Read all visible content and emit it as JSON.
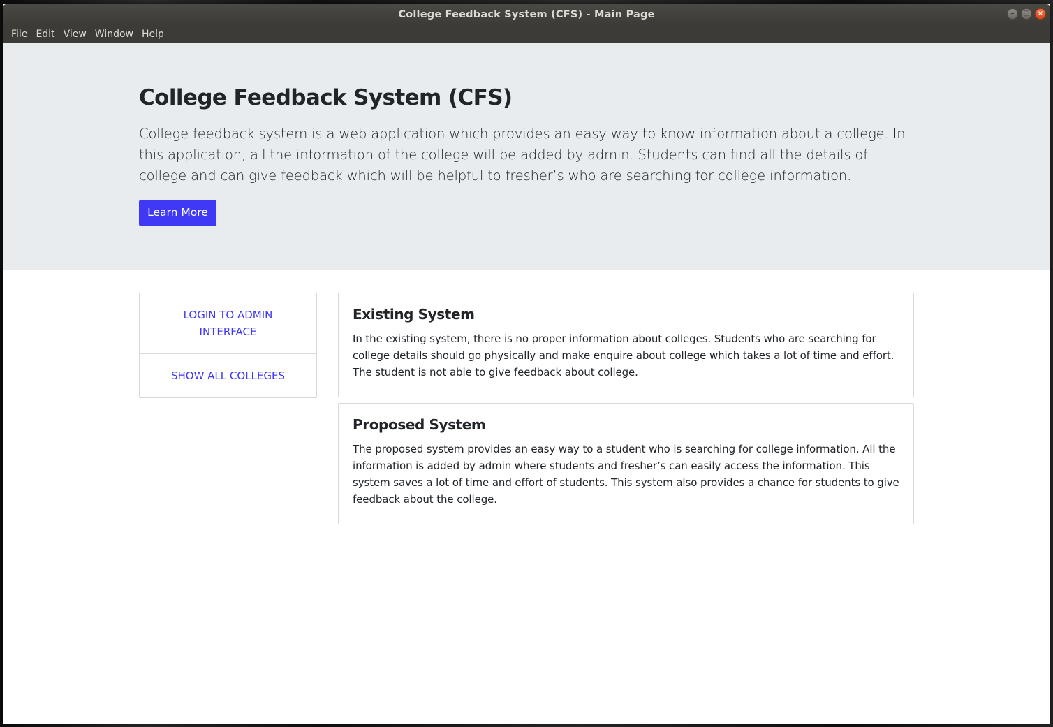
{
  "window": {
    "title": "College Feedback System (CFS) - Main Page",
    "controls": {
      "minimize": "–",
      "maximize": "□",
      "close": "×"
    }
  },
  "menubar": {
    "items": [
      {
        "label": "File"
      },
      {
        "label": "Edit"
      },
      {
        "label": "View"
      },
      {
        "label": "Window"
      },
      {
        "label": "Help"
      }
    ]
  },
  "jumbotron": {
    "title": "College Feedback System (CFS)",
    "lead": "College feedback system is a web application which provides an easy way to know information about a college. In this application, all the information of the college will be added by admin. Students can find all the details of college and can give feedback which will be helpful to fresher’s who are searching for college information.",
    "button_label": "Learn More"
  },
  "sidebar": {
    "links": [
      {
        "label": "LOGIN TO ADMIN INTERFACE"
      },
      {
        "label": "SHOW ALL COLLEGES"
      }
    ]
  },
  "cards": [
    {
      "title": "Existing System",
      "text": "In the existing system, there is no proper information about colleges. Students who are searching for college details should go physically and make enquire about college which takes a lot of time and effort. The student is not able to give feedback about college."
    },
    {
      "title": "Proposed System",
      "text": "The proposed system provides an easy way to a student who is searching for college information. All the information is added by admin where students and fresher’s can easily access the information. This system saves a lot of time and effort of students. This system also provides a chance for students to give feedback about the college."
    }
  ],
  "colors": {
    "primary": "#3f38f5",
    "jumbotron_bg": "#e9ecef",
    "titlebar_bg": "#3c3b37"
  }
}
